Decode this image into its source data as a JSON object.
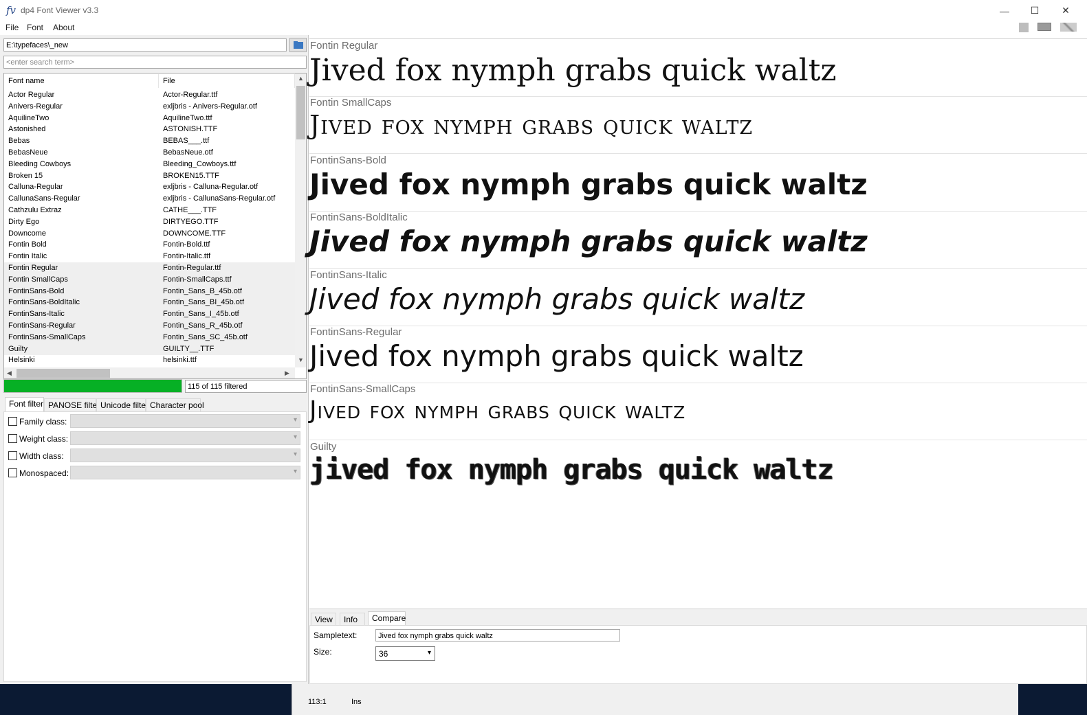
{
  "window": {
    "app_icon": "fv",
    "title": "dp4 Font Viewer v3.3",
    "controls": {
      "minimize": "—",
      "maximize": "☐",
      "close": "✕"
    }
  },
  "menu": {
    "items": [
      "File",
      "Font",
      "About"
    ],
    "icons": [
      "facebook-icon",
      "keyboard-icon",
      "uk-flag-icon"
    ]
  },
  "folder": {
    "path": "E:\\typefaces\\_new"
  },
  "search": {
    "placeholder": "<enter search term>"
  },
  "font_list": {
    "columns": [
      "Font name",
      "File"
    ],
    "rows": [
      {
        "name": "Actor Regular",
        "file": "Actor-Regular.ttf",
        "selected": false
      },
      {
        "name": "Anivers-Regular",
        "file": "exljbris - Anivers-Regular.otf",
        "selected": false
      },
      {
        "name": "AquilineTwo",
        "file": "AquilineTwo.ttf",
        "selected": false
      },
      {
        "name": "Astonished",
        "file": "ASTONISH.TTF",
        "selected": false
      },
      {
        "name": "Bebas",
        "file": "BEBAS___.ttf",
        "selected": false
      },
      {
        "name": "BebasNeue",
        "file": "BebasNeue.otf",
        "selected": false
      },
      {
        "name": "Bleeding Cowboys",
        "file": "Bleeding_Cowboys.ttf",
        "selected": false
      },
      {
        "name": "Broken 15",
        "file": "BROKEN15.TTF",
        "selected": false
      },
      {
        "name": "Calluna-Regular",
        "file": "exljbris - Calluna-Regular.otf",
        "selected": false
      },
      {
        "name": "CallunaSans-Regular",
        "file": "exljbris - CallunaSans-Regular.otf",
        "selected": false
      },
      {
        "name": "Cathzulu Extraz",
        "file": "CATHE___.TTF",
        "selected": false
      },
      {
        "name": "Dirty Ego",
        "file": "DIRTYEGO.TTF",
        "selected": false
      },
      {
        "name": "Downcome",
        "file": "DOWNCOME.TTF",
        "selected": false
      },
      {
        "name": "Fontin Bold",
        "file": "Fontin-Bold.ttf",
        "selected": false
      },
      {
        "name": "Fontin Italic",
        "file": "Fontin-Italic.ttf",
        "selected": false
      },
      {
        "name": "Fontin Regular",
        "file": "Fontin-Regular.ttf",
        "selected": true
      },
      {
        "name": "Fontin SmallCaps",
        "file": "Fontin-SmallCaps.ttf",
        "selected": true
      },
      {
        "name": "FontinSans-Bold",
        "file": "Fontin_Sans_B_45b.otf",
        "selected": true
      },
      {
        "name": "FontinSans-BoldItalic",
        "file": "Fontin_Sans_BI_45b.otf",
        "selected": true
      },
      {
        "name": "FontinSans-Italic",
        "file": "Fontin_Sans_I_45b.otf",
        "selected": true
      },
      {
        "name": "FontinSans-Regular",
        "file": "Fontin_Sans_R_45b.otf",
        "selected": true
      },
      {
        "name": "FontinSans-SmallCaps",
        "file": "Fontin_Sans_SC_45b.otf",
        "selected": true
      },
      {
        "name": "Guilty",
        "file": "GUILTY__.TTF",
        "selected": true
      },
      {
        "name": "Helsinki",
        "file": "helsinki.ttf",
        "selected": false
      }
    ]
  },
  "progress": {
    "fraction": 1.0,
    "count_text": "115 of 115 filtered",
    "color": "#06b025"
  },
  "filter_tabs": [
    "Font filter",
    "PANOSE filter",
    "Unicode filter",
    "Character pool"
  ],
  "filters": [
    {
      "label": "Family class:"
    },
    {
      "label": "Weight class:"
    },
    {
      "label": "Width class:"
    },
    {
      "label": "Monospaced:"
    }
  ],
  "samples": [
    {
      "font": "Fontin Regular",
      "text": "Jived fox nymph grabs quick waltz",
      "style": "regular"
    },
    {
      "font": "Fontin SmallCaps",
      "text": "Jived fox nymph grabs quick waltz",
      "style": "smallcaps"
    },
    {
      "font": "FontinSans-Bold",
      "text": "Jived fox nymph grabs quick waltz",
      "style": "bold"
    },
    {
      "font": "FontinSans-BoldItalic",
      "text": "Jived fox nymph grabs quick waltz",
      "style": "bolditalic"
    },
    {
      "font": "FontinSans-Italic",
      "text": "Jived fox nymph grabs quick waltz",
      "style": "italic"
    },
    {
      "font": "FontinSans-Regular",
      "text": "Jived fox nymph grabs quick waltz",
      "style": "sans"
    },
    {
      "font": "FontinSans-SmallCaps",
      "text": "Jived fox nymph grabs quick waltz",
      "style": "sanssmallcaps"
    },
    {
      "font": "Guilty",
      "text": "jived fox nymph grabs quick waltz",
      "style": "grunge"
    }
  ],
  "bottom_tabs": [
    "View",
    "Info",
    "Compare"
  ],
  "compare": {
    "sampletext_label": "Sampletext:",
    "sampletext_value": "Jived fox nymph grabs quick waltz",
    "size_label": "Size:",
    "size_value": "36"
  },
  "status": {
    "position": "113:1",
    "mode": "Ins"
  }
}
